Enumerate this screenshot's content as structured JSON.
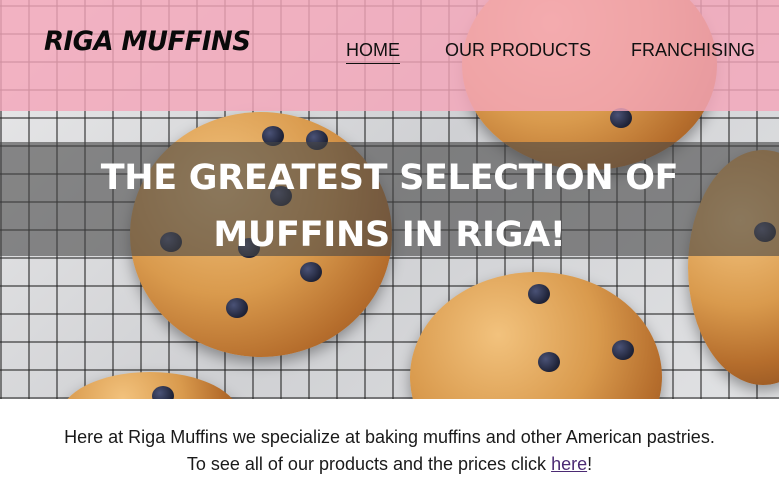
{
  "header": {
    "logo_text": "RIGA MUFFINS",
    "nav": [
      {
        "label": "HOME",
        "active": true
      },
      {
        "label": "OUR PRODUCTS",
        "active": false
      },
      {
        "label": "FRANCHISING",
        "active": false
      }
    ],
    "background_color": "#f4a6ba"
  },
  "hero": {
    "heading": "THE GREATEST SELECTION OF MUFFINS IN RIGA!",
    "image_subject": "blueberry muffins on a cooling rack"
  },
  "intro": {
    "line1": "Here at Riga Muffins we specialize at baking muffins and other American pastries.",
    "line2_prefix": "To see all of our products and the prices click ",
    "link_text": "here",
    "line2_suffix": "!"
  },
  "colors": {
    "link": "#4b2a73",
    "text": "#1a1a1a"
  }
}
